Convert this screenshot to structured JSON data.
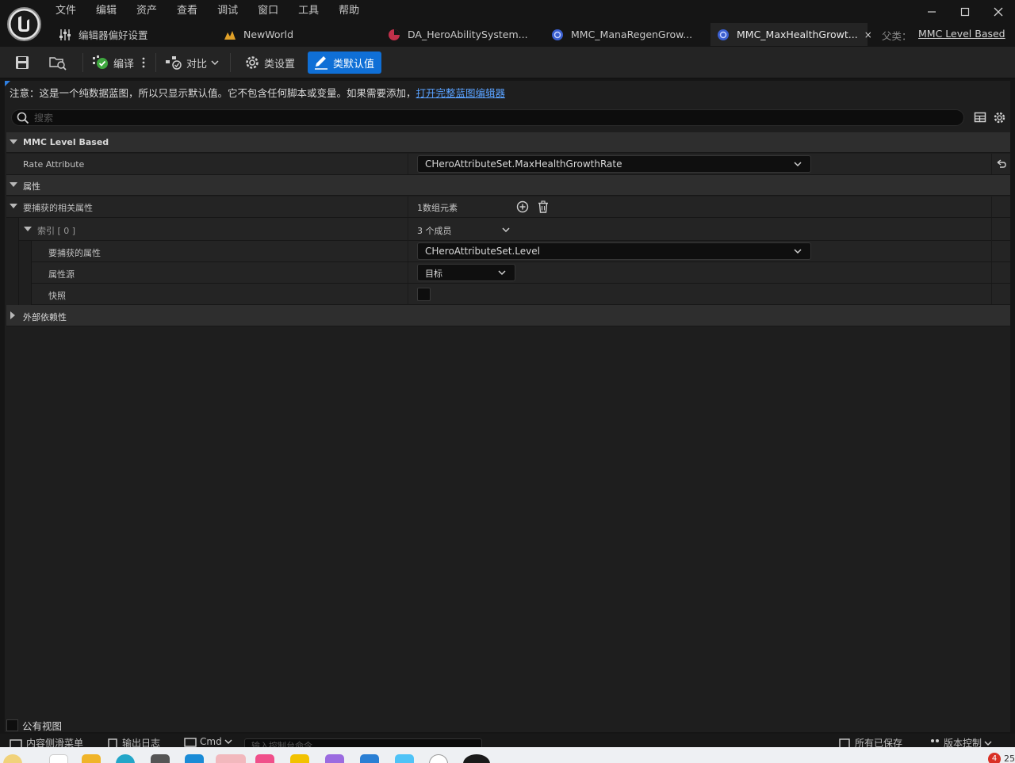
{
  "menu": [
    "文件",
    "编辑",
    "资产",
    "查看",
    "调试",
    "窗口",
    "工具",
    "帮助"
  ],
  "tabs": [
    {
      "label": "编辑器偏好设置",
      "icon": "sliders-icon"
    },
    {
      "label": "NewWorld",
      "icon": "level-icon"
    },
    {
      "label": "DA_HeroAbilitySystem...",
      "icon": "data-asset-icon"
    },
    {
      "label": "MMC_ManaRegenGrow...",
      "icon": "blueprint-icon"
    },
    {
      "label": "MMC_MaxHealthGrowt...",
      "icon": "blueprint-icon",
      "active": true,
      "close": "×"
    }
  ],
  "parent": {
    "label": "父类：",
    "value": "MMC Level Based"
  },
  "toolbar": {
    "compile": "编译",
    "diff": "对比",
    "class_settings": "类设置",
    "class_defaults": "类默认值"
  },
  "notice": {
    "text": "注意：这是一个纯数据蓝图，所以只显示默认值。它不包含任何脚本或变量。如果需要添加，",
    "link": "打开完整蓝图编辑器"
  },
  "search": {
    "placeholder": "搜索"
  },
  "details": {
    "cat_mmc": "MMC Level Based",
    "rate_attribute_label": "Rate Attribute",
    "rate_attribute_value": "CHeroAttributeSet.MaxHealthGrowthRate",
    "cat_attributes": "属性",
    "captured_label": "要捕获的相关属性",
    "captured_value": "1数组元素",
    "index_label": "索引 [ 0 ]",
    "index_value": "3 个成员",
    "capture_attr_label": "要捕获的属性",
    "capture_attr_value": "CHeroAttributeSet.Level",
    "attr_source_label": "属性源",
    "attr_source_value": "目标",
    "snapshot_label": "快照",
    "cat_external": "外部依赖性"
  },
  "public_view": "公有视图",
  "status": {
    "content_drawer": "内容侧滑菜单",
    "output_log": "输出日志",
    "cmd": "Cmd",
    "console_placeholder": "输入控制台命令",
    "all_saved": "所有已保存",
    "source_control": "版本控制"
  },
  "taskbar": {
    "badge": "4",
    "clock": "25"
  },
  "colors": {
    "accent": "#0f6fd6",
    "link": "#5aa2ff"
  }
}
